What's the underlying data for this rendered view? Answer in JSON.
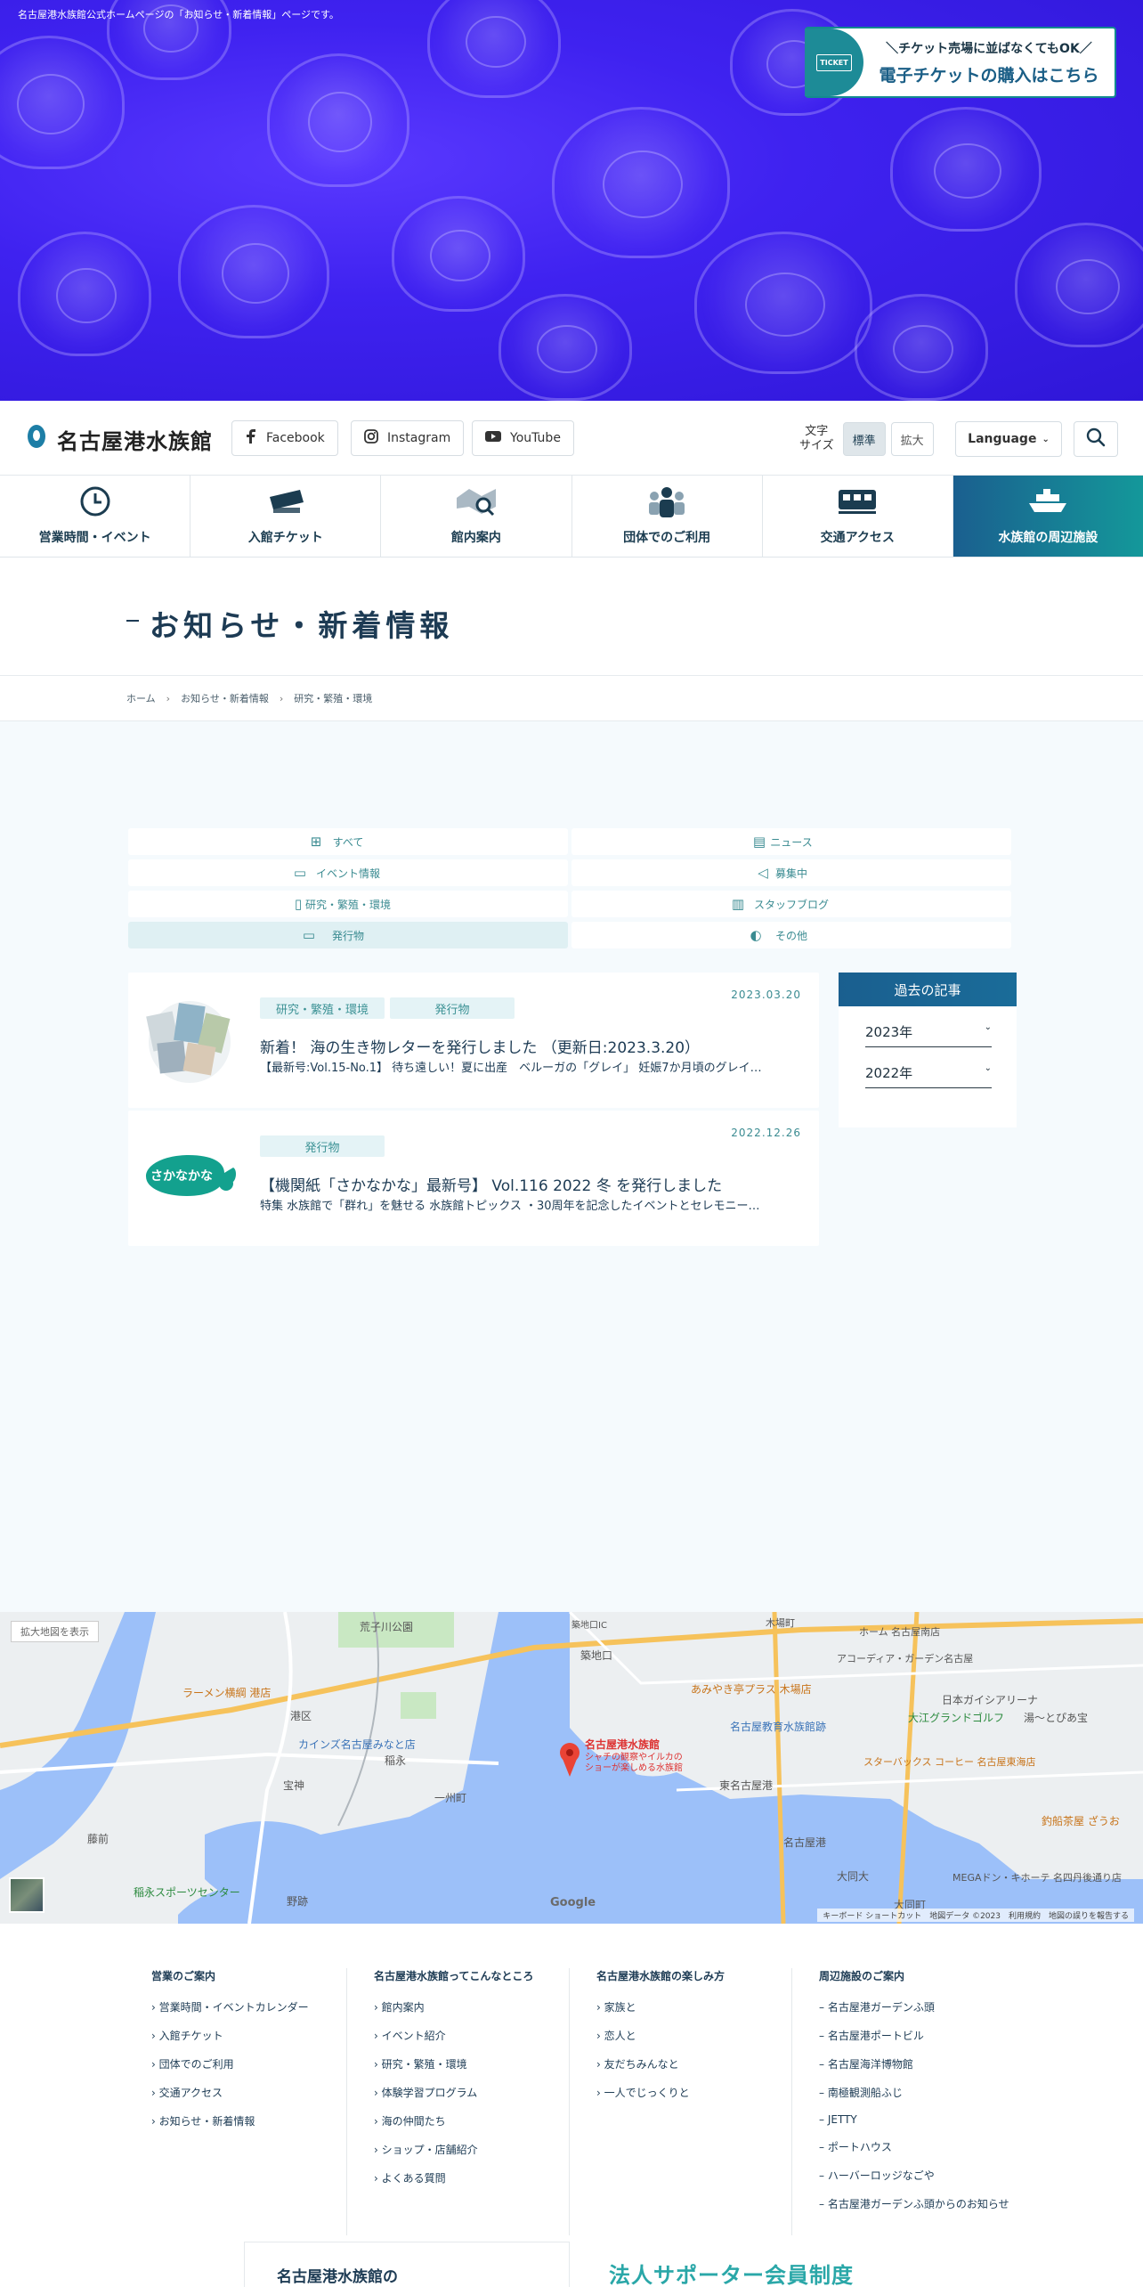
{
  "hero": {
    "caption": "名古屋港水族館公式ホームページの「お知らせ・新着情報」ページです。",
    "ticket_badge": "TICKET",
    "ticket_sub": "＼チケット売場に並ばなくてもOK／",
    "ticket_main": "電子チケットの購入はこちら"
  },
  "header": {
    "logo": "名古屋港水族館",
    "sns": [
      {
        "label": "Facebook",
        "icon": "facebook-icon"
      },
      {
        "label": "Instagram",
        "icon": "instagram-icon"
      },
      {
        "label": "YouTube",
        "icon": "youtube-icon"
      }
    ],
    "fontsize_label": "文字\nサイズ",
    "fontsize_normal": "標準",
    "fontsize_large": "拡大",
    "language": "Language"
  },
  "nav": [
    {
      "label": "営業時間・イベント",
      "icon": "clock-icon"
    },
    {
      "label": "入館チケット",
      "icon": "ticket-icon"
    },
    {
      "label": "館内案内",
      "icon": "map-search-icon"
    },
    {
      "label": "団体でのご利用",
      "icon": "group-icon"
    },
    {
      "label": "交通アクセス",
      "icon": "train-icon"
    },
    {
      "label": "水族館の周辺施設",
      "icon": "ship-icon"
    }
  ],
  "page_title": "お知らせ・新着情報",
  "breadcrumb": [
    "ホーム",
    "お知らせ・新着情報",
    "研究・繁殖・環境"
  ],
  "filters": [
    {
      "label": "すべて",
      "icon": "grid-icon"
    },
    {
      "label": "ニュース",
      "icon": "document-icon"
    },
    {
      "label": "イベント情報",
      "icon": "calendar-icon"
    },
    {
      "label": "募集中",
      "icon": "megaphone-icon"
    },
    {
      "label": "研究・繁殖・環境",
      "icon": "tablet-icon"
    },
    {
      "label": "スタッフブログ",
      "icon": "notebook-icon"
    },
    {
      "label": "発行物",
      "icon": "book-icon"
    },
    {
      "label": "その他",
      "icon": "fish-icon"
    }
  ],
  "articles": [
    {
      "tags": [
        "研究・繁殖・環境",
        "発行物"
      ],
      "date": "2023.03.20",
      "title": "新着！ 海の生き物レターを発行しました （更新日:2023.3.20）",
      "excerpt": "【最新号:Vol.15-No.1】 待ち遠しい！夏に出産　ベルーガの「グレイ」 妊娠7か月頃のグレイ…"
    },
    {
      "tags": [
        "発行物"
      ],
      "date": "2022.12.26",
      "title": "【機関紙「さかなかな」最新号】 Vol.116 2022 冬 を発行しました",
      "excerpt": "特集 水族館で「群れ」を魅せる 水族館トピックス ・30周年を記念したイベントとセレモニー…",
      "logo_text": "さかなかな"
    }
  ],
  "sidebar": {
    "title": "過去の記事",
    "years": [
      "2023年",
      "2022年"
    ]
  },
  "map": {
    "expand": "拡大地図を表示",
    "pin_name": "名古屋港水族館",
    "pin_desc": "シャチの観察やイルカの",
    "pin_desc2": "ショーが楽しめる水族館",
    "labels": [
      "荒子川公園",
      "港区",
      "ラーメン横綱 港店",
      "カインズ名古屋みなと店",
      "稲永",
      "宝神",
      "一州町",
      "藤前",
      "稲永スポーツセンター",
      "野跡",
      "築地口IC",
      "築地口",
      "名古屋教育水族館跡",
      "あみやき亭プラス 木場店",
      "日本ガイシアリーナ",
      "大江グランドゴルフ",
      "スターバックス コーヒー 名古屋東海店",
      "東名古屋港",
      "MEGAドン・キホーテ 名四丹後通り店",
      "大同町",
      "釣船茶屋 ざうお",
      "ホーム 名古屋南店",
      "アコーディア・ガーデン名古屋",
      "湯～とぴあ宝",
      "大同大",
      "名古屋港",
      "木場町"
    ],
    "google": "Google",
    "footer": "キーボード ショートカット　地図データ ©2023　利用規約　地図の誤りを報告する"
  },
  "footer": {
    "columns": [
      {
        "title": "営業のご案内",
        "items": [
          "営業時間・イベントカレンダー",
          "入館チケット",
          "団体でのご利用",
          "交通アクセス",
          "お知らせ・新着情報"
        ]
      },
      {
        "title": "名古屋港水族館ってこんなところ",
        "items": [
          "館内案内",
          "イベント紹介",
          "研究・繁殖・環境",
          "体験学習プログラム",
          "海の仲間たち",
          "ショップ・店舗紹介",
          "よくある質問"
        ]
      },
      {
        "title": "名古屋港水族館の楽しみ方",
        "items": [
          "家族と",
          "恋人と",
          "友だちみんなと",
          "一人でじっくりと"
        ]
      },
      {
        "title": "周辺施設のご案内",
        "items": [
          "名古屋港ガーデンふ頭",
          "名古屋港ポートビル",
          "名古屋海洋博物館",
          "南極観測船ふじ",
          "JETTY",
          "ポートハウス",
          "ハーバーロッジなごや",
          "名古屋港ガーデンふ頭からのお知らせ"
        ]
      }
    ],
    "promo_left": "名古屋港水族館の",
    "promo_right": "法人サポーター会員制度"
  },
  "colors": {
    "accent": "#1a5f8f",
    "teal": "#3a8b91",
    "hero": "#3f22f0"
  }
}
